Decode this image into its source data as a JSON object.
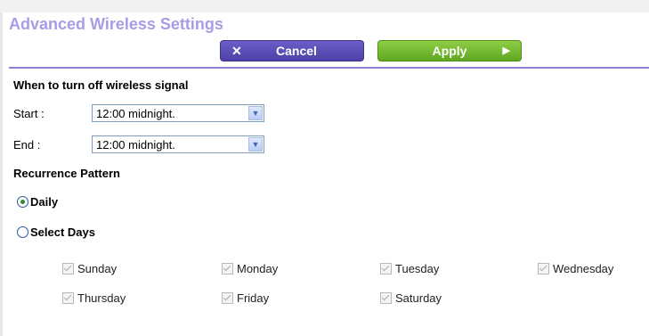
{
  "page": {
    "title": "Advanced Wireless Settings",
    "accent_color": "#a99be6"
  },
  "toolbar": {
    "cancel_label": "Cancel",
    "cancel_icon": "close-icon",
    "apply_label": "Apply",
    "apply_icon": "play-arrow-icon"
  },
  "schedule": {
    "heading": "When to turn off wireless signal",
    "start_label": "Start :",
    "start_value": "12:00 midnight.",
    "end_label": "End :",
    "end_value": "12:00 midnight."
  },
  "recurrence": {
    "heading": "Recurrence Pattern",
    "daily_label": "Daily",
    "daily_selected": true,
    "select_days_label": "Select Days",
    "select_days_selected": false,
    "days": [
      {
        "label": "Sunday",
        "checked": true,
        "disabled": true
      },
      {
        "label": "Monday",
        "checked": true,
        "disabled": true
      },
      {
        "label": "Tuesday",
        "checked": true,
        "disabled": true
      },
      {
        "label": "Wednesday",
        "checked": true,
        "disabled": true
      },
      {
        "label": "Thursday",
        "checked": true,
        "disabled": true
      },
      {
        "label": "Friday",
        "checked": true,
        "disabled": true
      },
      {
        "label": "Saturday",
        "checked": true,
        "disabled": true
      }
    ]
  }
}
